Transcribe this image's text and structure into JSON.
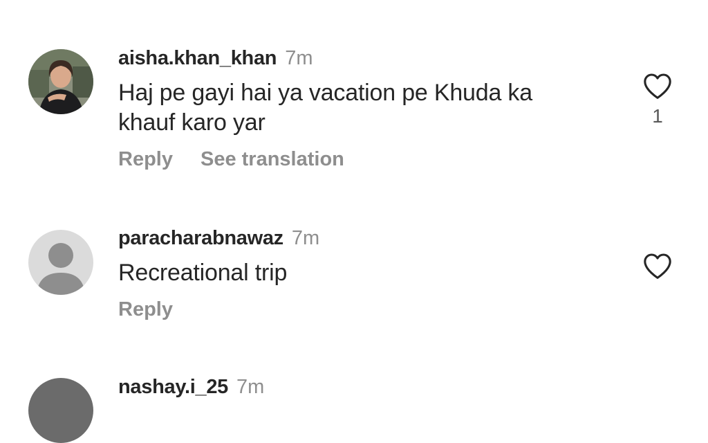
{
  "comments": [
    {
      "username": "aisha.khan_khan",
      "time": "7m",
      "text_lines": [
        "Haj pe gayi hai ya vacation pe Khuda ka",
        "khauf karo yar"
      ],
      "reply_label": "Reply",
      "translation_label": "See translation",
      "like_count": "1",
      "avatar": "profile-photo",
      "like_icon": "heart-outline-icon"
    },
    {
      "username": "paracharabnawaz",
      "time": "7m",
      "text": "Recreational trip",
      "reply_label": "Reply",
      "avatar": "default-avatar-icon",
      "like_icon": "heart-outline-icon"
    },
    {
      "username": "nashay.i_25",
      "time": "7m"
    }
  ],
  "colors": {
    "text": "#262626",
    "secondary": "#8e8e8e",
    "avatar_bg": "#dbdbdb",
    "avatar_silhouette": "#8e8e8e"
  }
}
